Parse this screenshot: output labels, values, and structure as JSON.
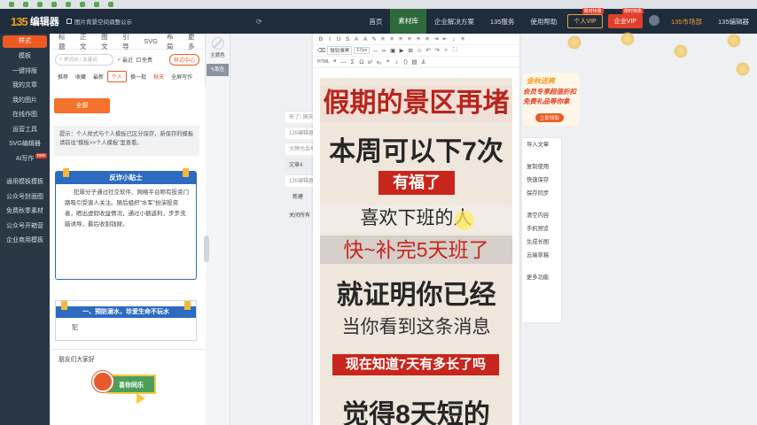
{
  "browser_tabs": [
    "",
    "",
    "",
    "",
    "",
    "",
    "",
    "",
    "",
    "",
    "",
    ""
  ],
  "header": {
    "logo_mark": "135",
    "logo_text": "编辑器",
    "tip": "图片背景空间调整公示",
    "nav": [
      "首页",
      "素材库",
      "企业解决方案",
      "135服务",
      "使用帮助"
    ],
    "active_nav": "素材库",
    "vip_personal": "个人VIP",
    "vip_personal_tag": "限时特惠",
    "vip_enterprise": "企业VIP",
    "vip_enterprise_tag": "限时特惠",
    "user1": "135市场部",
    "user2": "135编辑器"
  },
  "sidebar": {
    "items": [
      {
        "label": "样式",
        "active": true
      },
      {
        "label": "模板"
      },
      {
        "label": "一键排版"
      },
      {
        "label": "我的文章"
      },
      {
        "label": "我的图片"
      },
      {
        "label": "在线作图"
      },
      {
        "label": "运营工具"
      },
      {
        "label": "SVG编辑器"
      },
      {
        "label": "AI写作",
        "badge": "new"
      }
    ],
    "items2": [
      {
        "label": "通用模板模板"
      },
      {
        "label": "公众号封面图"
      },
      {
        "label": "免费秋季素材"
      },
      {
        "label": "公众号开箱营"
      },
      {
        "label": "企业商用模板"
      }
    ]
  },
  "panel": {
    "tabs": [
      "标题",
      "正文",
      "图文",
      "引导",
      "SVG",
      "布局",
      "更多"
    ],
    "search_placeholder": "样式ID / 关键词",
    "opt_latest": "最近",
    "opt_free": "免费",
    "style_center": "样式中心",
    "filters": [
      "推荐",
      "收藏",
      "最新",
      "个人",
      "换一批",
      "秋天",
      "全屏写作"
    ],
    "active_filter": "个人",
    "red_filter": "秋天",
    "all_button": "全部",
    "tip_text": "提示：个人样式与个人模板已区分保存，新保存的模板请前往\"模板>>个人模板\"里查看。",
    "card1_title": "反诈小贴士",
    "card1_body": "犯罪分子通过社交软件、网络平台称有投资门路吸引受害人关注。随后组织\"水军\"扮演投资者，晒出虚假收益情况，通过小额返利，步步洗脑诱导，最后收割钱财。",
    "card2_title": "一、预防溺水，珍爱生命不玩水",
    "card2_body": "犯",
    "card3_title": "朋友们大家好",
    "banner_text": "喜你同乐"
  },
  "color_tools": {
    "theme_color": "主题色",
    "pick_color": "取色"
  },
  "recent": {
    "items": [
      "来了! 国庆",
      "135编辑器",
      "大牌也会举",
      "文章4",
      "135编辑器"
    ],
    "new_btn": "新建",
    "close_all": "关闭所有"
  },
  "editor": {
    "font_select": "微软雅黑",
    "size_select": "17px",
    "lines": [
      "假期的景区再堵",
      "本周可以下7次",
      "有福了",
      "喜欢下班的人",
      "快~补完5天班了",
      "就证明你已经",
      "当你看到这条消息",
      "现在知道7天有多长了吗",
      "觉得8天短的"
    ]
  },
  "right_panel": {
    "buttons": [
      "导入文章",
      "复制使用",
      "快速保存",
      "保存同步",
      "清空内容",
      "手机预览",
      "生成长图",
      "云端草稿",
      "更多功能"
    ]
  },
  "ad": {
    "line1": "金秋送爽",
    "line2": "会员专享超值折扣",
    "line3": "免费礼品等你拿",
    "button": "立即领取"
  },
  "colors": {
    "accent": "#f05a22",
    "header_bg": "#1f2c3c",
    "sidebar_bg": "#2a3846",
    "card_blue": "#2c6bc0",
    "doc_red": "#c8261c"
  }
}
